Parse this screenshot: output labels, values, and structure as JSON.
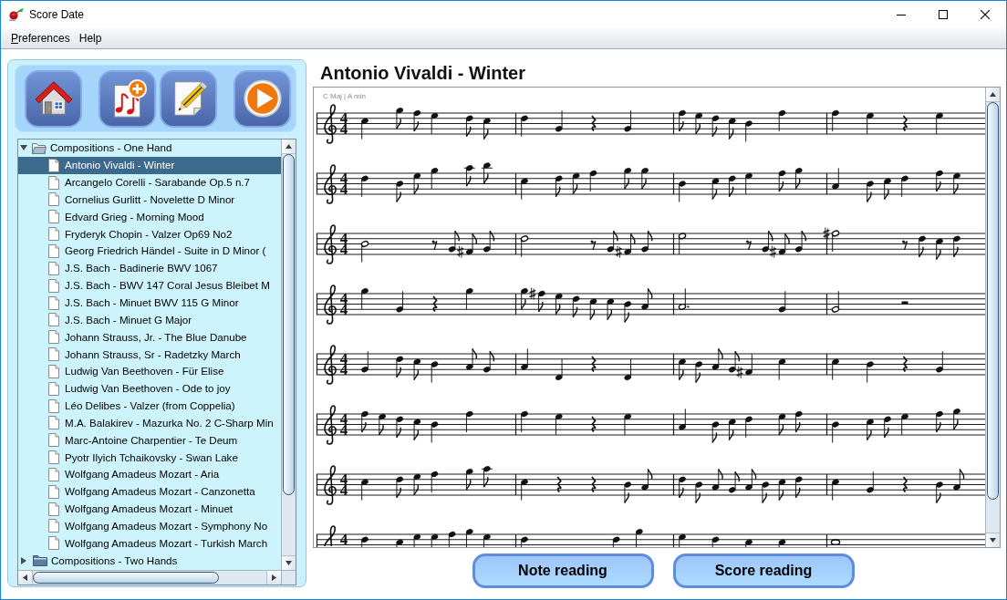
{
  "window": {
    "title": "Score Date"
  },
  "menu": [
    {
      "label": "Preferences",
      "mnemonic": true
    },
    {
      "label": "Help",
      "mnemonic": false
    }
  ],
  "toolbar": [
    {
      "kind": "home"
    },
    {
      "kind": "add"
    },
    {
      "kind": "edit"
    },
    {
      "kind": "play"
    }
  ],
  "tree": {
    "items": [
      {
        "label": "Compositions - One Hand",
        "expanded": true,
        "selected": false,
        "children": [
          {
            "label": "Antonio Vivaldi - Winter",
            "selected": true
          },
          {
            "label": "Arcangelo Corelli - Sarabande Op.5 n.7",
            "selected": false
          },
          {
            "label": "Cornelius Gurlitt - Novelette D Minor",
            "selected": false
          },
          {
            "label": "Edvard Grieg - Morning Mood",
            "selected": false
          },
          {
            "label": "Fryderyk Chopin - Valzer Op69 No2",
            "selected": false
          },
          {
            "label": "Georg Friedrich Händel - Suite in D Minor (",
            "selected": false
          },
          {
            "label": "J.S. Bach - Badinerie BWV 1067",
            "selected": false
          },
          {
            "label": "J.S. Bach - BWV 147 Coral Jesus Bleibet M",
            "selected": false
          },
          {
            "label": "J.S. Bach - Minuet BWV 115 G Minor",
            "selected": false
          },
          {
            "label": "J.S. Bach - Minuet G Major",
            "selected": false
          },
          {
            "label": "Johann Strauss, Jr. - The Blue Danube",
            "selected": false
          },
          {
            "label": "Johann Strauss, Sr - Radetzky March",
            "selected": false
          },
          {
            "label": "Ludwig Van Beethoven - Für Elise",
            "selected": false
          },
          {
            "label": "Ludwig Van Beethoven - Ode to joy",
            "selected": false
          },
          {
            "label": "Léo Delibes - Valzer (from Coppelia)",
            "selected": false
          },
          {
            "label": "M.A. Balakirev - Mazurka No. 2 C-Sharp Min",
            "selected": false
          },
          {
            "label": "Marc-Antoine Charpentier - Te Deum",
            "selected": false
          },
          {
            "label": "Pyotr Ilyich Tchaikovsky - Swan Lake",
            "selected": false
          },
          {
            "label": "Wolfgang Amadeus Mozart - Aria",
            "selected": false
          },
          {
            "label": "Wolfgang Amadeus Mozart - Canzonetta",
            "selected": false
          },
          {
            "label": "Wolfgang Amadeus Mozart - Minuet",
            "selected": false
          },
          {
            "label": "Wolfgang Amadeus Mozart - Symphony No",
            "selected": false
          },
          {
            "label": "Wolfgang Amadeus Mozart - Turkish March",
            "selected": false
          }
        ]
      },
      {
        "label": "Compositions - Two Hands",
        "expanded": false,
        "selected": false
      }
    ]
  },
  "score": {
    "title": "Antonio Vivaldi - Winter",
    "key": "C Maj | A min",
    "staves": [
      {
        "beats": "4",
        "beat_unit": "4"
      },
      {
        "beats": "4",
        "beat_unit": "4"
      },
      {
        "beats": "4",
        "beat_unit": "4"
      },
      {
        "beats": "4",
        "beat_unit": "4"
      },
      {
        "beats": "4",
        "beat_unit": "4"
      },
      {
        "beats": "4",
        "beat_unit": "4"
      },
      {
        "beats": "4",
        "beat_unit": "4"
      },
      {
        "beats": "4"
      }
    ]
  },
  "buttons": [
    "Note reading",
    "Score reading"
  ]
}
